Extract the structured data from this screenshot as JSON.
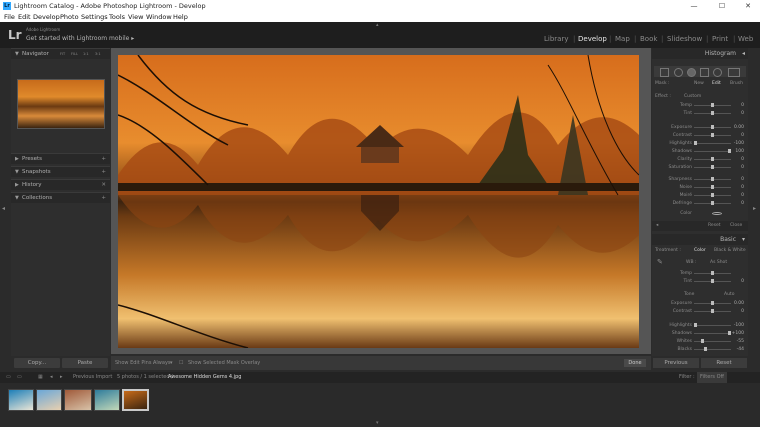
{
  "window": {
    "title": "Lightroom Catalog - Adobe Photoshop Lightroom - Develop",
    "app_icon": "Lr",
    "minimize": "—",
    "maximize": "☐",
    "close": "✕"
  },
  "menubar": [
    "File",
    "Edit",
    "Develop",
    "Photo",
    "Settings",
    "Tools",
    "View",
    "Window",
    "Help"
  ],
  "topbar": {
    "logo": "Lr",
    "brand_small": "Adobe Lightroom",
    "mobile_prompt": "Get started with Lightroom mobile",
    "mobile_arrow": "▸",
    "modules": [
      "Library",
      "Develop",
      "Map",
      "Book",
      "Slideshow",
      "Print",
      "Web"
    ],
    "active_module": "Develop"
  },
  "left_panel": {
    "navigator": {
      "label": "Navigator",
      "zoom": [
        "FIT",
        "FILL",
        "1:1",
        "3:1"
      ]
    },
    "sections": [
      {
        "label": "Presets",
        "tri": "▶"
      },
      {
        "label": "Snapshots",
        "tri": "▼"
      },
      {
        "label": "History",
        "tri": "▶"
      },
      {
        "label": "Collections",
        "tri": "▼"
      }
    ],
    "copy_label": "Copy...",
    "paste_label": "Paste"
  },
  "center_toolbar": {
    "show_edit_pins_label": "Show Edit Pins :",
    "show_edit_pins_value": "Always",
    "overlay_label": "Show Selected Mask Overlay",
    "done_label": "Done"
  },
  "right_panel": {
    "histogram_label": "Histogram",
    "mask_label": "Mask :",
    "mask_options": [
      "New",
      "Edit",
      "Brush"
    ],
    "effect_label": "Effect :",
    "effect_value": "Custom",
    "adjustments": [
      {
        "name": "Temp",
        "value": "0",
        "level": 0.5
      },
      {
        "name": "Tint",
        "value": "0",
        "level": 0.5
      },
      {
        "name": "Exposure",
        "value": "0.00",
        "level": 0.5
      },
      {
        "name": "Contrast",
        "value": "0",
        "level": 0.5
      },
      {
        "name": "Highlights",
        "value": "-100",
        "level": 0.0
      },
      {
        "name": "Shadows",
        "value": "100",
        "level": 1.0
      },
      {
        "name": "Clarity",
        "value": "0",
        "level": 0.5
      },
      {
        "name": "Saturation",
        "value": "0",
        "level": 0.5
      },
      {
        "name": "Sharpness",
        "value": "0",
        "level": 0.5
      },
      {
        "name": "Noise",
        "value": "0",
        "level": 0.5
      },
      {
        "name": "Moiré",
        "value": "0",
        "level": 0.5
      },
      {
        "name": "Defringe",
        "value": "0",
        "level": 0.5
      }
    ],
    "color_label": "Color",
    "reset_label": "Reset",
    "close_label": "Close",
    "basic_label": "Basic",
    "treatment_label": "Treatment :",
    "treatment_options": [
      "Color",
      "Black & White"
    ],
    "wb_label": "WB :",
    "wb_value": "As Shot",
    "basic_wb": [
      {
        "name": "Temp",
        "value": "",
        "level": 0.5
      },
      {
        "name": "Tint",
        "value": "0",
        "level": 0.5
      }
    ],
    "tone_label": "Tone",
    "auto_label": "Auto",
    "basic_tone": [
      {
        "name": "Exposure",
        "value": "0.00",
        "level": 0.5
      },
      {
        "name": "Contrast",
        "value": "0",
        "level": 0.5
      }
    ],
    "basic_presence": [
      {
        "name": "Highlights",
        "value": "-100",
        "level": 0.0
      },
      {
        "name": "Shadows",
        "value": "+100",
        "level": 1.0
      },
      {
        "name": "Whites",
        "value": "-55",
        "level": 0.22
      },
      {
        "name": "Blacks",
        "value": "-44",
        "level": 0.28
      }
    ],
    "previous_label": "Previous",
    "reset_btn_label": "Reset"
  },
  "filmbar": {
    "prev_import": "Previous Import",
    "count": "5 photos / 1 selected /",
    "filename": "Awesome Hidden Gems 4.jpg",
    "filter_label": "Filter :",
    "filter_value": "Filters Off"
  },
  "filmstrip": {
    "selected_index": 4,
    "thumbs": [
      {
        "colors": [
          "#1d7fb8",
          "#e9e5d6"
        ]
      },
      {
        "colors": [
          "#6aa7d8",
          "#e8d0b0"
        ]
      },
      {
        "colors": [
          "#a05a3a",
          "#d8c2a8"
        ]
      },
      {
        "colors": [
          "#2e7c9c",
          "#c2d8b8"
        ]
      },
      {
        "colors": [
          "#c76b1a",
          "#3a2410"
        ]
      }
    ]
  },
  "icons": {
    "panel_arrow_left": "◂",
    "panel_arrow_right": "▸",
    "panel_arrow_up": "▴",
    "panel_arrow_down": "▾",
    "plus": "+"
  }
}
